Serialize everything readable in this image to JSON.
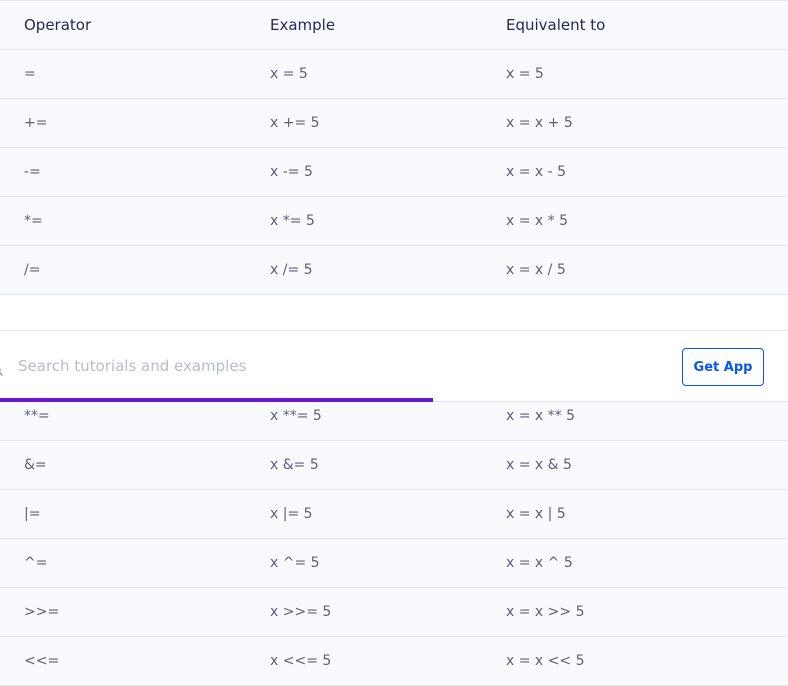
{
  "table": {
    "headers": [
      "Operator",
      "Example",
      "Equivalent to"
    ],
    "rows_top": [
      [
        "=",
        "x = 5",
        "x = 5"
      ],
      [
        "+=",
        "x += 5",
        "x = x + 5"
      ],
      [
        "-=",
        "x -= 5",
        "x = x - 5"
      ],
      [
        "*=",
        "x *= 5",
        "x = x * 5"
      ],
      [
        "/=",
        "x /= 5",
        "x = x / 5"
      ]
    ],
    "rows_bottom": [
      [
        "**=",
        "x **= 5",
        "x = x ** 5"
      ],
      [
        "&=",
        "x &= 5",
        "x = x & 5"
      ],
      [
        "|=",
        "x |= 5",
        "x = x | 5"
      ],
      [
        "^=",
        "x ^= 5",
        "x = x ^ 5"
      ],
      [
        ">>=",
        "x >>= 5",
        "x = x >> 5"
      ],
      [
        "<<=",
        "x <<= 5",
        "x = x << 5"
      ]
    ]
  },
  "search": {
    "placeholder": "Search tutorials and examples",
    "value": "",
    "icon": "search-icon",
    "progress_fraction": 0.55
  },
  "get_app": {
    "label": "Get App"
  },
  "colors": {
    "accent": "#0556f3",
    "progress": "#6a16d4",
    "row_background": "#f9fafe"
  }
}
